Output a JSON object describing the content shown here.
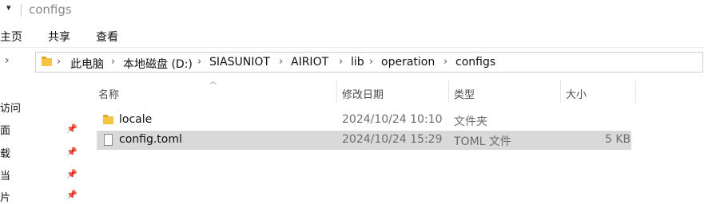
{
  "window": {
    "title": "configs"
  },
  "ribbon": {
    "tabs": [
      {
        "label": "主页"
      },
      {
        "label": "共享"
      },
      {
        "label": "查看"
      }
    ]
  },
  "address": {
    "crumbs": [
      "此电脑",
      "本地磁盘 (D:)",
      "SIASUNIOT",
      "AIRIOT",
      "lib",
      "operation",
      "configs"
    ]
  },
  "columns": {
    "name": "名称",
    "modified": "修改日期",
    "type": "类型",
    "size": "大小"
  },
  "files": [
    {
      "name": "locale",
      "modified": "2024/10/24 10:10",
      "type": "文件夹",
      "size": "",
      "icon": "folder-icon"
    },
    {
      "name": "config.toml",
      "modified": "2024/10/24 15:29",
      "type": "TOML 文件",
      "size": "5 KB",
      "icon": "file-icon"
    }
  ],
  "sidebar": {
    "items": [
      {
        "label": "访问"
      },
      {
        "label": "面"
      },
      {
        "label": "载"
      },
      {
        "label": "当"
      },
      {
        "label": "片"
      }
    ]
  },
  "colors": {
    "selected_row": "#d9d9d9",
    "folder": "#f6c342"
  }
}
